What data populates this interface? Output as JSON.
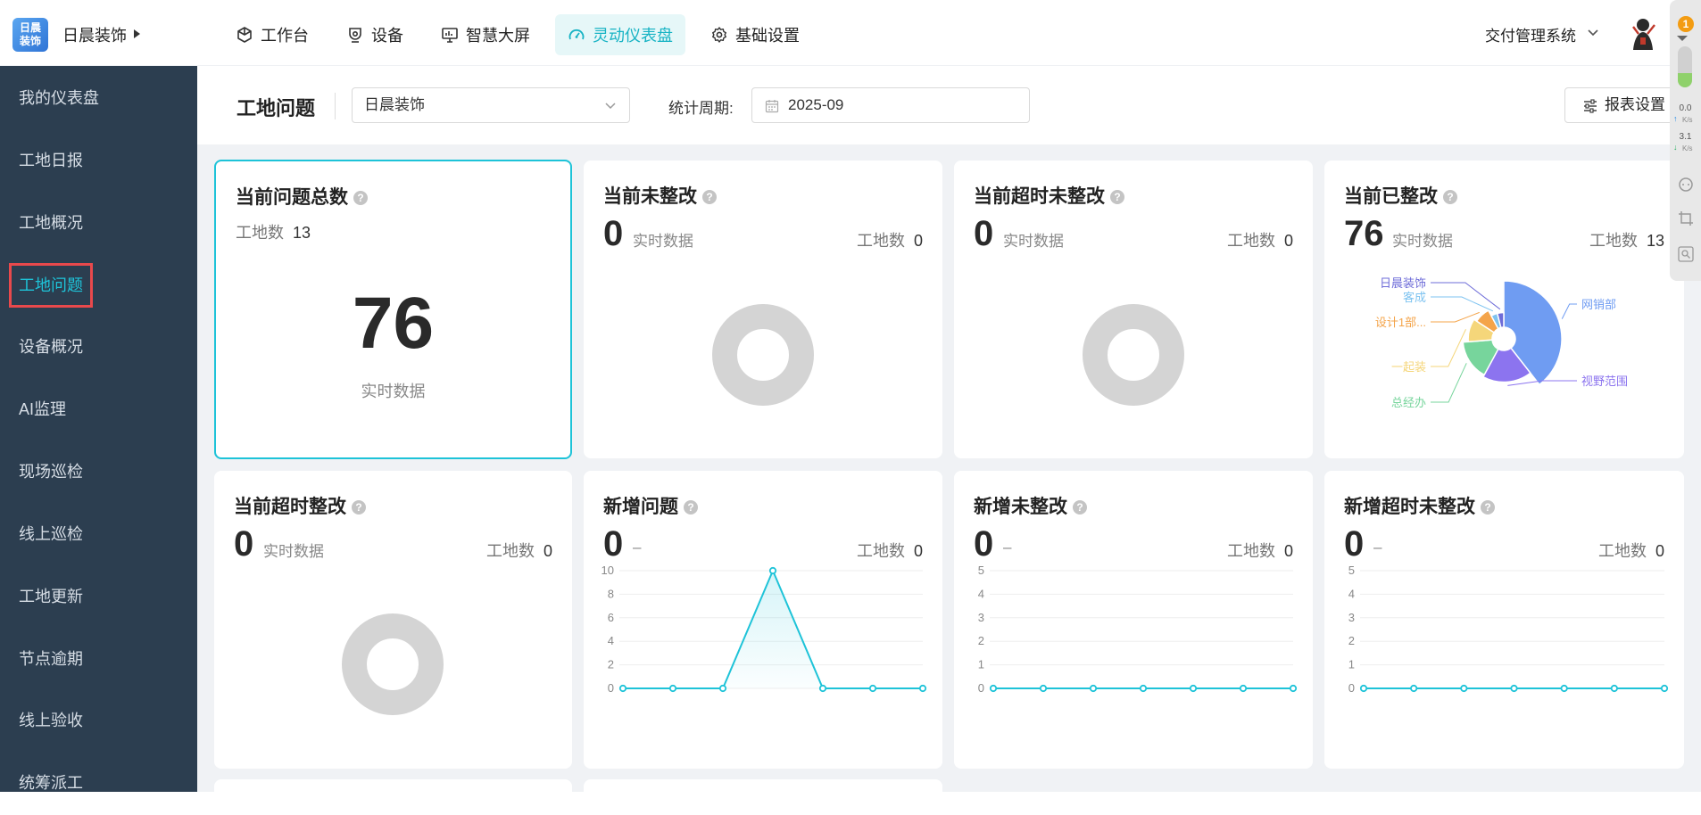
{
  "brand": {
    "logo_text": "日晨装饰",
    "name": "日晨装饰"
  },
  "nav": [
    {
      "label": "工作台",
      "icon": "cube-icon"
    },
    {
      "label": "设备",
      "icon": "camera-icon"
    },
    {
      "label": "智慧大屏",
      "icon": "monitor-icon"
    },
    {
      "label": "灵动仪表盘",
      "icon": "dashboard-icon",
      "active": true
    },
    {
      "label": "基础设置",
      "icon": "gear-icon"
    }
  ],
  "header": {
    "system_label": "交付管理系统",
    "badge_count": "1"
  },
  "side_panel": {
    "up_speed": "0.0",
    "down_speed": "3.1",
    "unit": "K/s"
  },
  "sidebar": {
    "items": [
      {
        "label": "我的仪表盘"
      },
      {
        "label": "工地日报"
      },
      {
        "label": "工地概况"
      },
      {
        "label": "工地问题",
        "active": true
      },
      {
        "label": "设备概况"
      },
      {
        "label": "AI监理"
      },
      {
        "label": "现场巡检"
      },
      {
        "label": "线上巡检"
      },
      {
        "label": "工地更新"
      },
      {
        "label": "节点逾期"
      },
      {
        "label": "线上验收"
      },
      {
        "label": "统筹派工"
      }
    ]
  },
  "filters": {
    "page_title": "工地问题",
    "company_value": "日晨装饰",
    "period_label": "统计周期:",
    "period_value": "2025-09",
    "report_button": "报表设置"
  },
  "cards": [
    {
      "title": "当前问题总数",
      "site_label": "工地数",
      "site_count": "13",
      "value": "76",
      "sub": "实时数据"
    },
    {
      "title": "当前未整改",
      "value": "0",
      "sub": "实时数据",
      "site_label": "工地数",
      "site_count": "0"
    },
    {
      "title": "当前超时未整改",
      "value": "0",
      "sub": "实时数据",
      "site_label": "工地数",
      "site_count": "0"
    },
    {
      "title": "当前已整改",
      "value": "76",
      "sub": "实时数据",
      "site_label": "工地数",
      "site_count": "13"
    },
    {
      "title": "当前超时整改",
      "value": "0",
      "sub": "实时数据",
      "site_label": "工地数",
      "site_count": "0"
    },
    {
      "title": "新增问题",
      "value": "0",
      "sub": "–",
      "site_label": "工地数",
      "site_count": "0"
    },
    {
      "title": "新增未整改",
      "value": "0",
      "sub": "–",
      "site_label": "工地数",
      "site_count": "0"
    },
    {
      "title": "新增超时未整改",
      "value": "0",
      "sub": "–",
      "site_label": "工地数",
      "site_count": "0"
    }
  ],
  "chart_data": [
    {
      "type": "pie",
      "variant": "rose",
      "labels": [
        "网销部",
        "视野范围",
        "总经办",
        "一起装",
        "设计1部...",
        "客成",
        "日晨装饰"
      ],
      "colors": [
        "#6f9cf2",
        "#8c74ef",
        "#77d59c",
        "#f5d67a",
        "#f4a44a",
        "#7ec3f0",
        "#6e6cd8"
      ],
      "values": [
        30,
        14,
        12,
        8,
        6,
        3,
        3
      ]
    },
    {
      "type": "line",
      "title": "新增问题",
      "x_count": 7,
      "values": [
        0,
        0,
        0,
        10,
        0,
        0,
        0
      ],
      "ylim": [
        0,
        10
      ],
      "yticks": [
        "10",
        "8",
        "6",
        "4",
        "2",
        "0"
      ],
      "color": "#1ec3d8",
      "area": true
    },
    {
      "type": "line",
      "title": "新增未整改",
      "x_count": 7,
      "values": [
        0,
        0,
        0,
        0,
        0,
        0,
        0
      ],
      "ylim": [
        0,
        5
      ],
      "yticks": [
        "5",
        "4",
        "3",
        "2",
        "1",
        "0"
      ],
      "color": "#1ec3d8"
    },
    {
      "type": "line",
      "title": "新增超时未整改",
      "x_count": 7,
      "values": [
        0,
        0,
        0,
        0,
        0,
        0,
        0
      ],
      "ylim": [
        0,
        5
      ],
      "yticks": [
        "5",
        "4",
        "3",
        "2",
        "1",
        "0"
      ],
      "color": "#1ec3d8"
    }
  ]
}
